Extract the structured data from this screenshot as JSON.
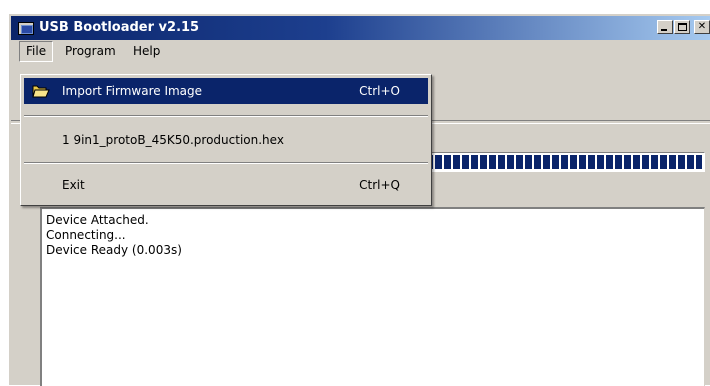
{
  "window": {
    "title": "USB Bootloader v2.15",
    "controls": [
      "minimize",
      "maximize",
      "close"
    ]
  },
  "menubar": {
    "items": [
      {
        "label": "File",
        "active": true
      },
      {
        "label": "Program"
      },
      {
        "label": "Help"
      }
    ]
  },
  "file_menu": {
    "items": [
      {
        "label": "Import Firmware Image",
        "shortcut": "Ctrl+O",
        "icon": "open-folder-icon",
        "highlighted": true
      },
      {
        "label": "1 9in1_protoB_45K50.production.hex"
      },
      {
        "label": "Exit",
        "shortcut": "Ctrl+Q"
      }
    ]
  },
  "progress": {
    "percent": 100,
    "color": "#0a246a"
  },
  "log": {
    "lines": [
      "Device Attached.",
      "Connecting...",
      "Device Ready (0.003s)"
    ]
  },
  "colors": {
    "titlebar_start": "#0a246a",
    "titlebar_end": "#a6caf0",
    "face": "#d4d0c8",
    "highlight": "#0a246a"
  }
}
